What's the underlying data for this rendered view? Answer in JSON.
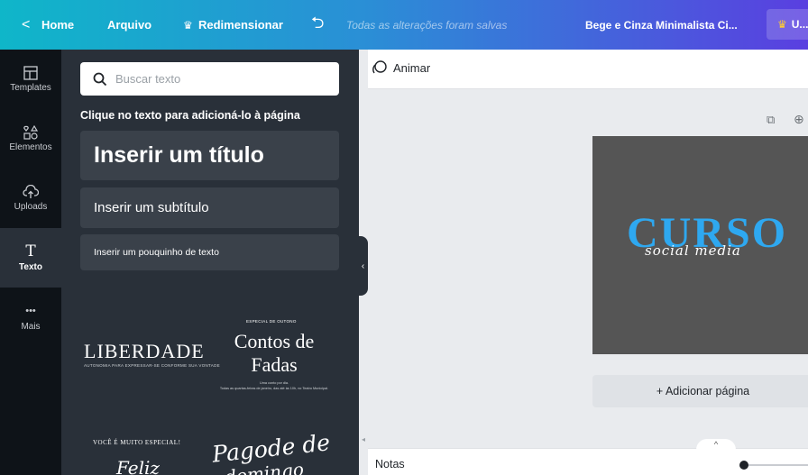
{
  "header": {
    "back_glyph": "<",
    "home": "Home",
    "arquivo": "Arquivo",
    "redimensionar": "Redimensionar",
    "undo_glyph": "⮌",
    "saved_status": "Todas as alterações foram salvas",
    "design_title": "Bege e Cinza Minimalista Ci...",
    "upgrade_label": "U...",
    "crown_glyph": "♛"
  },
  "rail": {
    "items": [
      {
        "label": "Templates",
        "icon": "templates-icon"
      },
      {
        "label": "Elementos",
        "icon": "elements-icon"
      },
      {
        "label": "Uploads",
        "icon": "upload-cloud-icon"
      },
      {
        "label": "Texto",
        "icon": "text-icon"
      },
      {
        "label": "Mais",
        "icon": "more-icon"
      }
    ],
    "text_glyph": "T",
    "more_glyph": "•••"
  },
  "panel": {
    "search_placeholder": "Buscar texto",
    "hint": "Clique no texto para adicioná-lo à página",
    "add_heading": "Inserir um título",
    "add_subheading": "Inserir um subtítulo",
    "add_body": "Inserir um pouquinho de texto",
    "combo1": {
      "left_title": "LIBERDADE",
      "left_sub": "AUTONOMIA PARA EXPRESSAR-SE CONFORME SUA VONTADE",
      "right_top": "ESPECIAL DE OUTONO",
      "right_title": "Contos de Fadas",
      "right_foot1": "Uma conto por dia.",
      "right_foot2": "Todas as quartas-feiras de janeiro, das até às 10h, no Teatro Municipal."
    },
    "combo2": {
      "left_top": "VOCÊ É MUITO ESPECIAL!",
      "left_script": "Feliz",
      "right_script": "Pagode de",
      "right_script2": "domingo"
    },
    "collapse_glyph": "‹"
  },
  "canvas": {
    "animar": "Animar",
    "copy_glyph": "⧉",
    "add_glyph": "⊕",
    "design_word": "CURSO",
    "design_script": "social media",
    "design_bg": "#555555",
    "design_accent": "#2ea8f0",
    "add_page": "+ Adicionar página",
    "notes_tab_glyph": "^",
    "scroll_glyph": "◂"
  },
  "footer": {
    "notas": "Notas"
  }
}
